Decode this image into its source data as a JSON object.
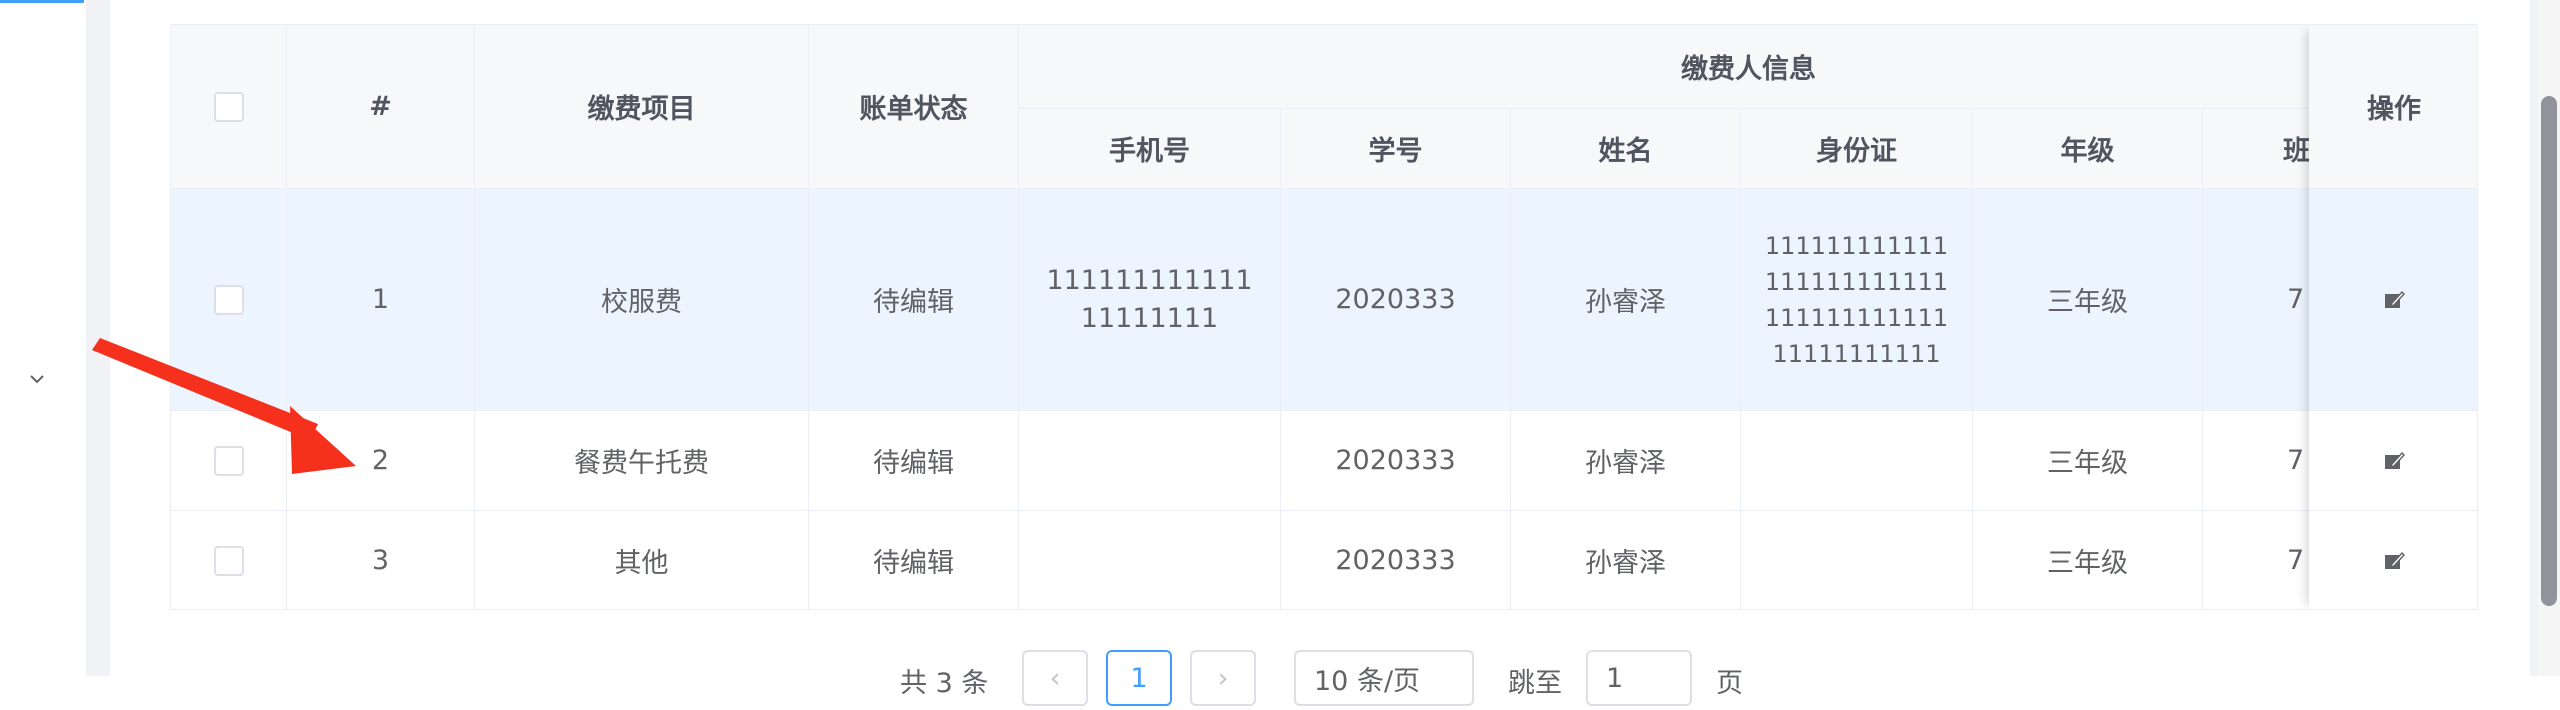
{
  "table": {
    "header": {
      "index": "#",
      "item": "缴费项目",
      "status": "账单状态",
      "payer_group": "缴费人信息",
      "phone": "手机号",
      "student_no": "学号",
      "name": "姓名",
      "id_card": "身份证",
      "grade": "年级",
      "class_partial": "班",
      "ops": "操作"
    },
    "rows": [
      {
        "index": "1",
        "item": "校服费",
        "status": "待编辑",
        "phone": "11111111111111111111",
        "student_no": "2020333",
        "name": "孙睿泽",
        "id_card": "11111111111111111111111111111111111111111111111",
        "grade": "三年级",
        "class_partial": "7"
      },
      {
        "index": "2",
        "item": "餐费午托费",
        "status": "待编辑",
        "phone": "",
        "student_no": "2020333",
        "name": "孙睿泽",
        "id_card": "",
        "grade": "三年级",
        "class_partial": "7"
      },
      {
        "index": "3",
        "item": "其他",
        "status": "待编辑",
        "phone": "",
        "student_no": "2020333",
        "name": "孙睿泽",
        "id_card": "",
        "grade": "三年级",
        "class_partial": "7"
      }
    ]
  },
  "pagination": {
    "total": "共 3 条",
    "prev": "‹",
    "current": "1",
    "next": "›",
    "page_size": "10 条/页",
    "goto": "跳至",
    "goto_value": "1",
    "page_unit": "页"
  },
  "colors": {
    "accent": "#409eff",
    "highlight_row": "#ecf5ff",
    "annotation_arrow": "#f5311e"
  },
  "icons": {
    "sidebar_expand": "chevron-down-icon",
    "row_edit": "edit-icon"
  }
}
